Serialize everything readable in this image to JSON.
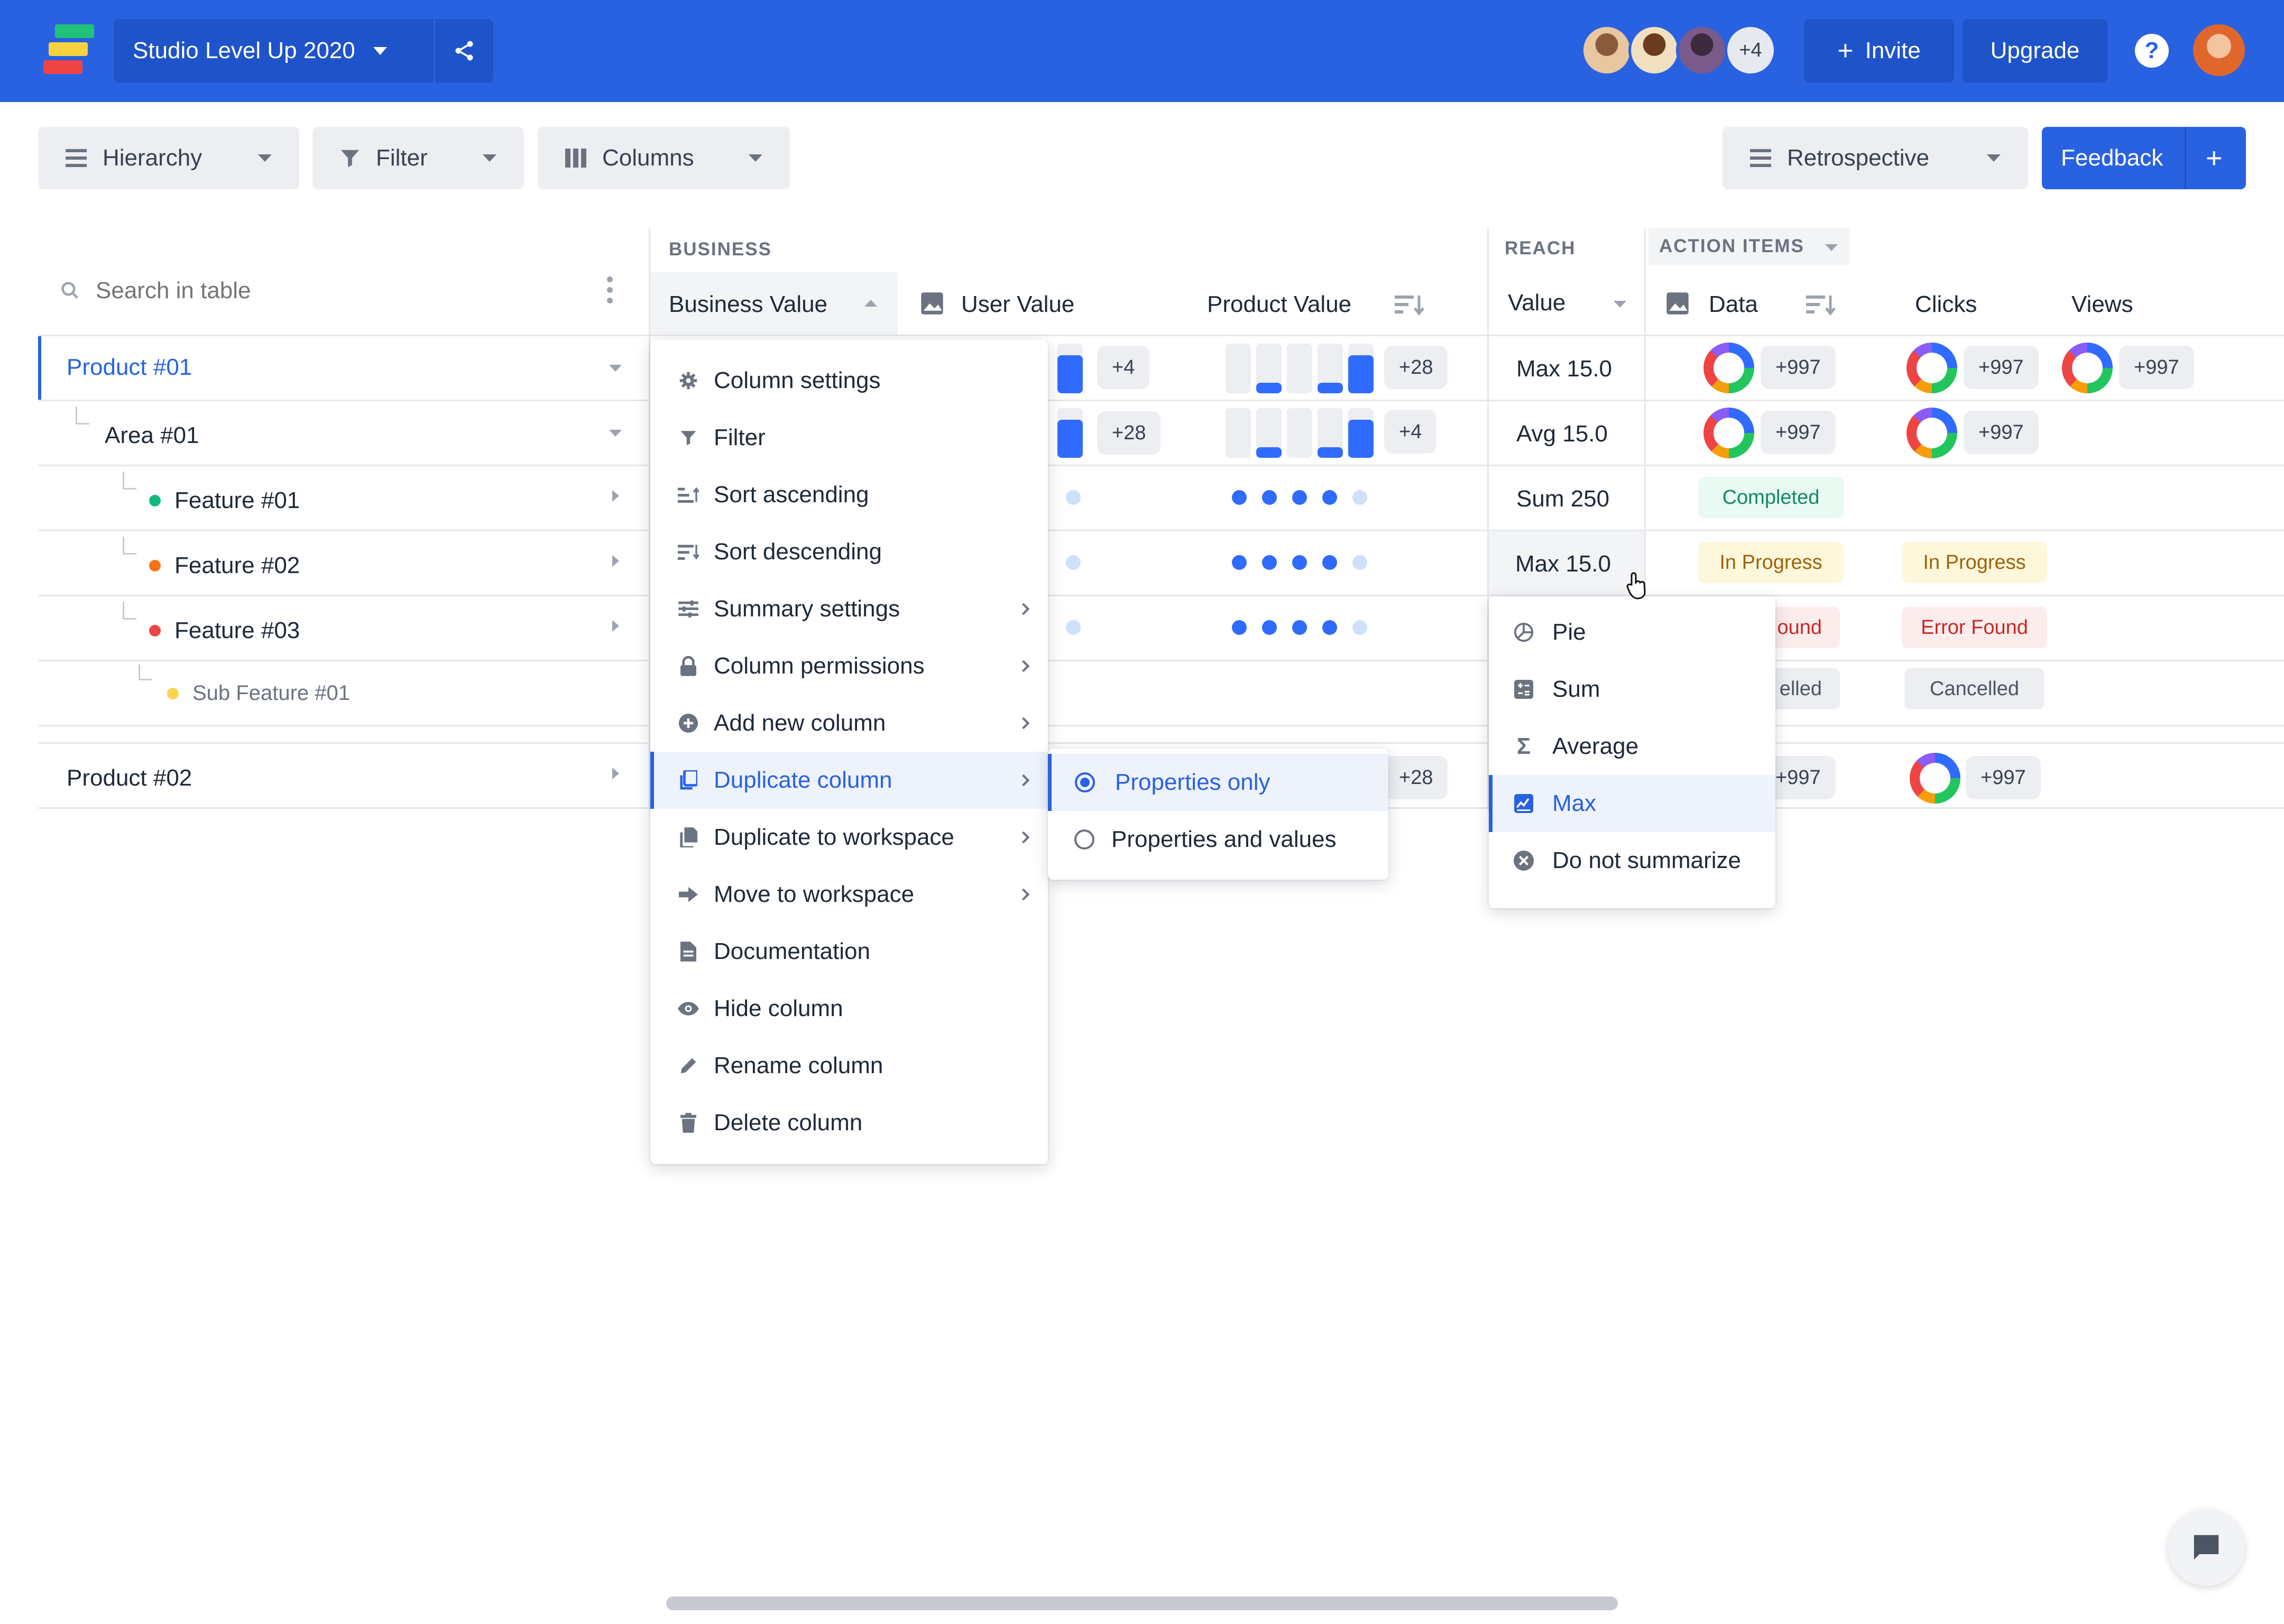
{
  "app": {
    "workspace_name": "Studio Level Up 2020",
    "extra_members": "+4",
    "invite_label": "Invite",
    "upgrade_label": "Upgrade",
    "help_label": "?"
  },
  "toolbar": {
    "hierarchy_label": "Hierarchy",
    "filter_label": "Filter",
    "columns_label": "Columns",
    "view_label": "Retrospective",
    "feedback_label": "Feedback",
    "feedback_plus": "+"
  },
  "table": {
    "search_placeholder": "Search in table",
    "groups": {
      "business": "BUSINESS",
      "reach": "REACH",
      "action_items": "ACTION ITEMS"
    },
    "columns": {
      "business_value": "Business Value",
      "user_value": "User Value",
      "product_value": "Product Value",
      "value": "Value",
      "data": "Data",
      "clicks": "Clicks",
      "views": "Views"
    },
    "rows": {
      "product1": "Product #01",
      "area1": "Area #01",
      "feature1": "Feature #01",
      "feature2": "Feature #02",
      "feature3": "Feature #03",
      "subfeature1": "Sub Feature #01",
      "product2": "Product #02"
    },
    "cells": {
      "uv_r1_count": "+4",
      "uv_r2_count": "+28",
      "pv_r1_count": "+28",
      "pv_r2_count": "+4",
      "r7_count": "+28",
      "value_r1": "Max 15.0",
      "value_r2": "Avg 15.0",
      "value_r3": "Sum 250",
      "value_r4": "Max 15.0",
      "data_count": "+997",
      "status_completed": "Completed",
      "status_in_progress": "In Progress",
      "status_error_partial": "ound",
      "status_error": "Error Found",
      "status_cancelled_partial": "elled",
      "status_cancelled": "Cancelled"
    }
  },
  "column_menu": {
    "items": [
      "Column settings",
      "Filter",
      "Sort ascending",
      "Sort descending",
      "Summary settings",
      "Column permissions",
      "Add new column",
      "Duplicate column",
      "Duplicate to workspace",
      "Move to workspace",
      "Documentation",
      "Hide column",
      "Rename column",
      "Delete column"
    ],
    "active_item": "Duplicate column"
  },
  "duplicate_submenu": {
    "items": [
      "Properties only",
      "Properties and values"
    ],
    "selected": "Properties only"
  },
  "summary_menu": {
    "items": [
      "Pie",
      "Sum",
      "Average",
      "Max",
      "Do not summarize"
    ],
    "selected": "Max"
  },
  "colors": {
    "brand": "#2962e0",
    "completed_bg": "#e9faf3",
    "completed_text": "#0f8a5f",
    "progress_bg": "#fdf7dc",
    "progress_text": "#a16207",
    "error_bg": "#fdecec",
    "error_text": "#c62828",
    "cancelled_bg": "#eceef1",
    "cancelled_text": "#4b5563"
  }
}
